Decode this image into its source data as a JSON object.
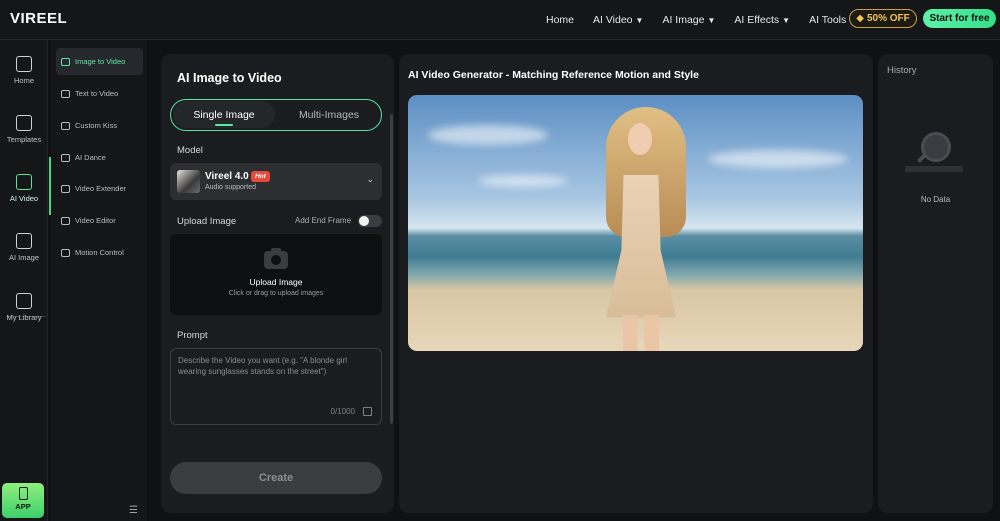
{
  "brand": {
    "logo": "VIREEL"
  },
  "topnav": {
    "items": [
      {
        "label": "Home",
        "dropdown": false
      },
      {
        "label": "AI Video",
        "dropdown": true
      },
      {
        "label": "AI Image",
        "dropdown": true
      },
      {
        "label": "AI Effects",
        "dropdown": true
      },
      {
        "label": "AI Tools",
        "dropdown": true
      }
    ],
    "promo": "50% OFF",
    "start": "Start for free"
  },
  "leftnav": {
    "items": [
      {
        "label": "Home",
        "icon": "home-icon"
      },
      {
        "label": "Templates",
        "icon": "templates-icon"
      },
      {
        "label": "AI Video",
        "icon": "ai-video-icon",
        "active": true
      },
      {
        "label": "AI Image",
        "icon": "ai-image-icon"
      },
      {
        "label": "My Library",
        "icon": "library-icon"
      }
    ],
    "app": "APP"
  },
  "subnav": {
    "items": [
      {
        "label": "Image to Video",
        "active": true
      },
      {
        "label": "Text to Video"
      },
      {
        "label": "Custom Kiss"
      },
      {
        "label": "AI Dance"
      },
      {
        "label": "Video Extender"
      },
      {
        "label": "Video Editor"
      },
      {
        "label": "Motion Control"
      }
    ]
  },
  "form": {
    "title": "AI Image to Video",
    "tabs": [
      "Single Image",
      "Multi-Images"
    ],
    "model_label": "Model",
    "model_name": "Vireel 4.0",
    "model_badge": "Hot",
    "model_sub": "Audio supported",
    "upload_label": "Upload Image",
    "end_frame_label": "Add End Frame",
    "end_frame_on": false,
    "upload_title": "Upload Image",
    "upload_hint": "Click or drag to upload images",
    "prompt_label": "Prompt",
    "prompt_placeholder": "Describe the Video you want (e.g. \"A blonde girl wearing sunglasses stands on the street\")",
    "prompt_count": "0/1000",
    "create": "Create"
  },
  "center": {
    "title": "AI Video Generator - Matching Reference Motion and Style"
  },
  "history": {
    "title": "History",
    "empty": "No Data"
  },
  "colors": {
    "accent": "#58e3a2",
    "promo": "#f2c35d",
    "hot": "#e84a3a"
  }
}
